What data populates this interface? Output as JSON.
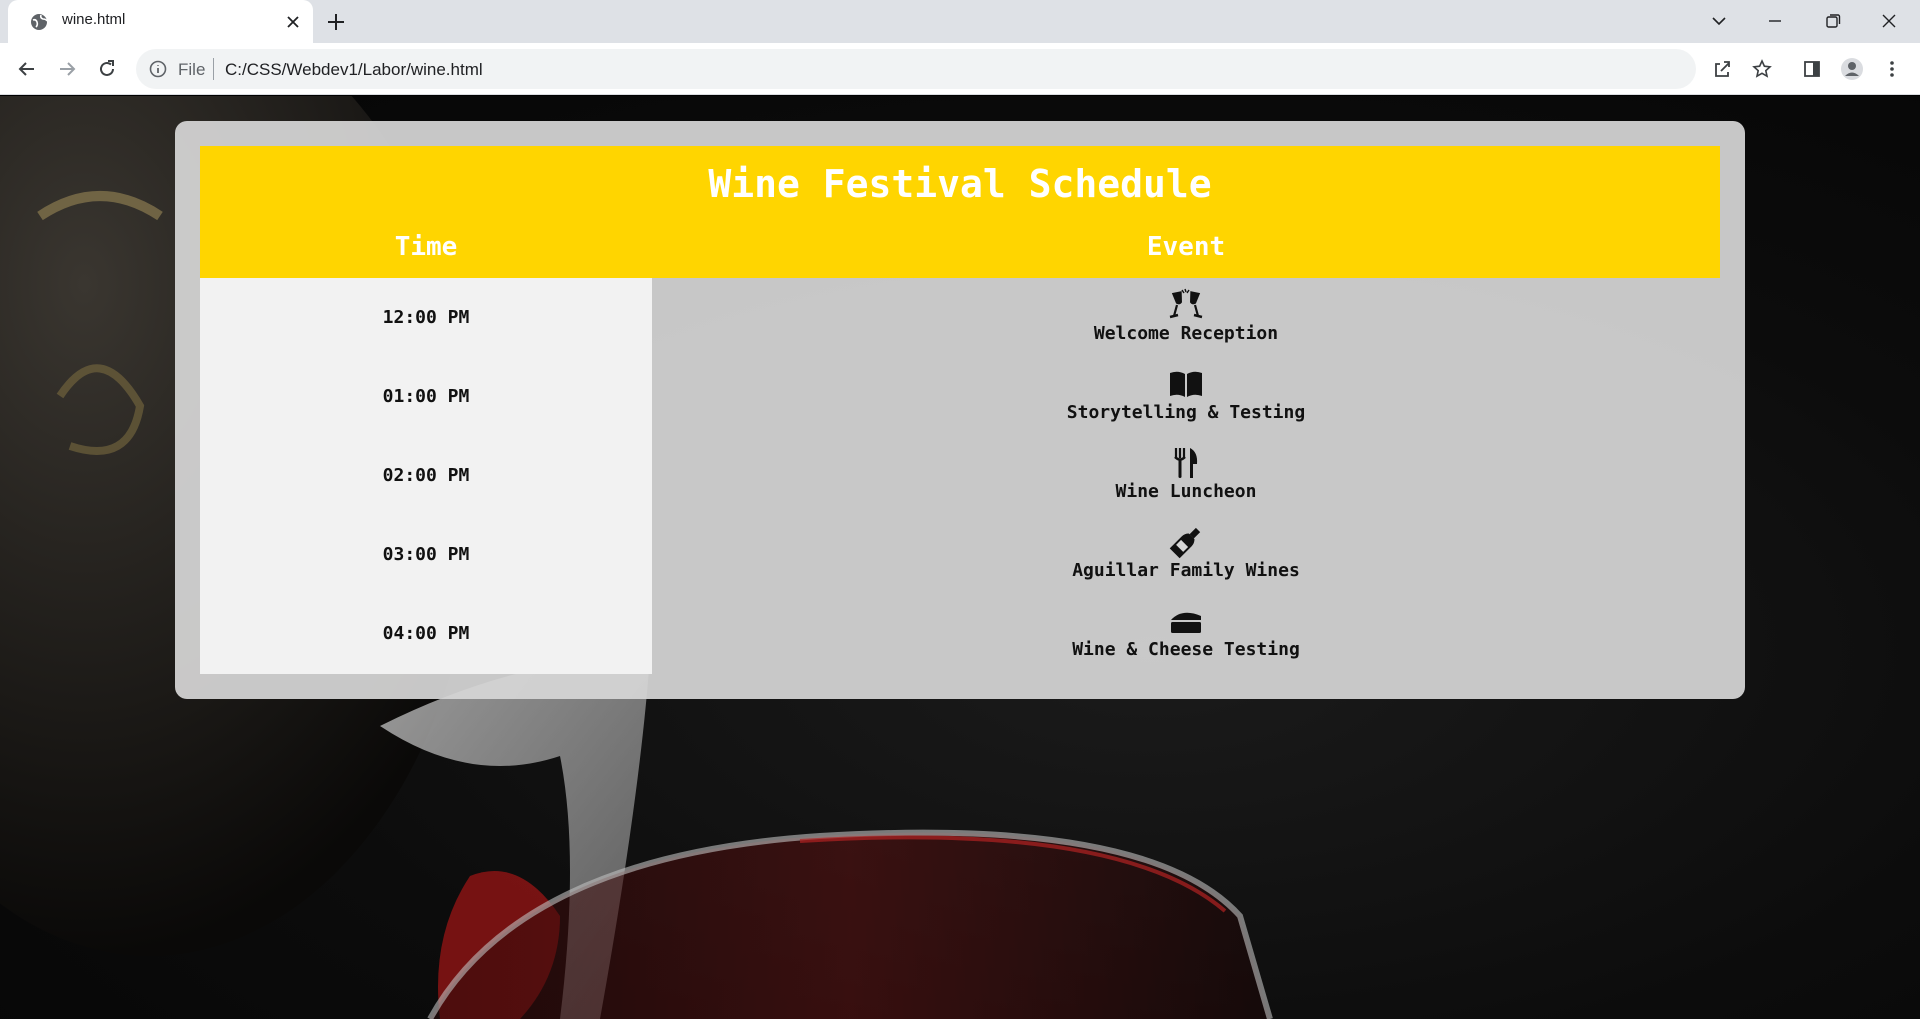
{
  "browser": {
    "tab_title": "wine.html",
    "scheme_label": "File",
    "url": "C:/CSS/Webdev1/Labor/wine.html"
  },
  "schedule": {
    "title": "Wine Festival Schedule",
    "headers": {
      "time": "Time",
      "event": "Event"
    },
    "rows": [
      {
        "time": "12:00 PM",
        "event": "Welcome Reception",
        "icon": "wine-glasses-icon"
      },
      {
        "time": "01:00 PM",
        "event": "Storytelling & Testing",
        "icon": "book-icon"
      },
      {
        "time": "02:00 PM",
        "event": "Wine Luncheon",
        "icon": "utensils-icon"
      },
      {
        "time": "03:00 PM",
        "event": "Aguillar Family Wines",
        "icon": "wine-bottle-icon"
      },
      {
        "time": "04:00 PM",
        "event": "Wine & Cheese Testing",
        "icon": "cheese-icon"
      }
    ]
  },
  "colors": {
    "header_yellow": "#ffd500",
    "time_column_bg": "#f2f2f2",
    "card_bg": "#d6d6d6"
  }
}
